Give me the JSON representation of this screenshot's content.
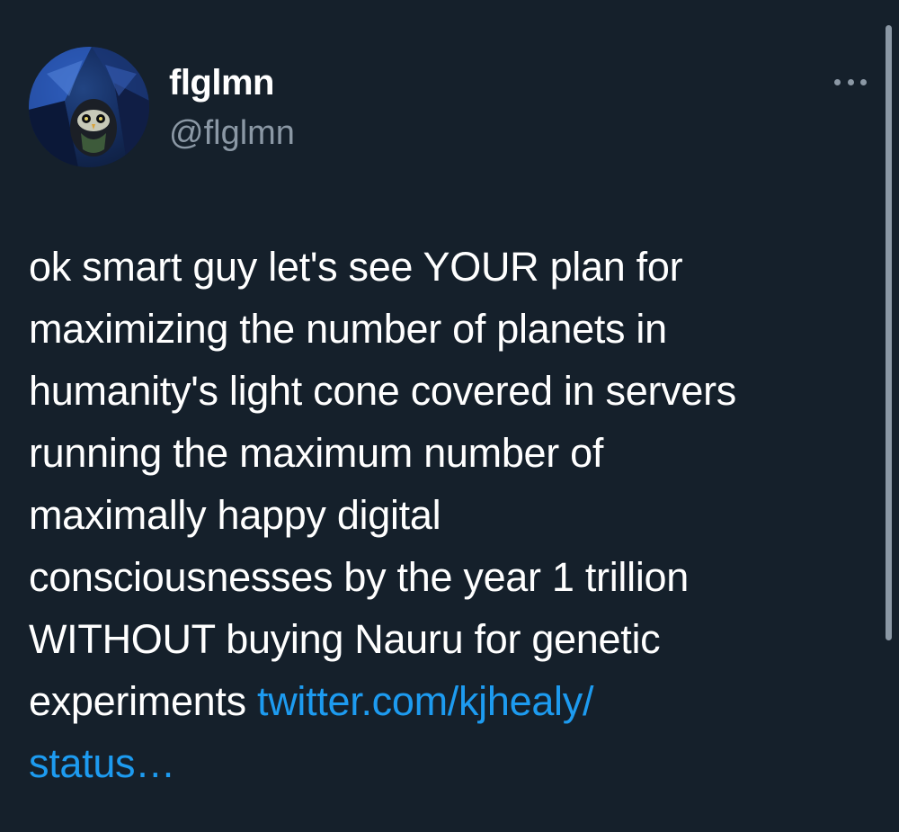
{
  "author": {
    "display_name": "flglmn",
    "handle": "@flglmn",
    "avatar_icon": "owl-avatar-icon"
  },
  "menu": {
    "more_icon": "more-dots-icon"
  },
  "tweet": {
    "lines": [
      "ok smart guy let's see YOUR plan for",
      "maximizing the number of planets in",
      "humanity's light cone covered in servers",
      "running the maximum number of",
      "maximally happy digital",
      "consciousnesses by the year 1 trillion",
      "WITHOUT buying Nauru for genetic"
    ],
    "last_line_text": "experiments ",
    "link_part1": "twitter.com/kjhealy/",
    "link_part2": "status…"
  },
  "colors": {
    "background": "#15202b",
    "text": "#ffffff",
    "secondary": "#8b98a5",
    "link": "#1d9bf0"
  }
}
